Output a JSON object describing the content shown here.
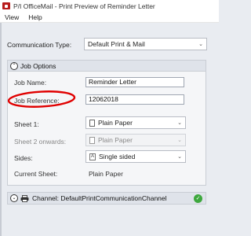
{
  "window": {
    "title": "P/I OfficeMail - Print Preview of Reminder Letter",
    "app_icon": "officemail-app-icon"
  },
  "menu": {
    "items": [
      {
        "label": "View"
      },
      {
        "label": "Help"
      }
    ]
  },
  "communication_type": {
    "label": "Communication Type:",
    "value": "Default Print & Mail"
  },
  "job_options": {
    "title": "Job Options",
    "expanded": true,
    "job_name": {
      "label": "Job Name:",
      "value": "Reminder Letter"
    },
    "job_reference": {
      "label": "Job Reference:",
      "value": "12062018"
    },
    "sheet1": {
      "label": "Sheet 1:",
      "value": "Plain Paper"
    },
    "sheet2": {
      "label": "Sheet 2 onwards:",
      "value": "Plain Paper"
    },
    "sides": {
      "label": "Sides:",
      "value": "Single sided"
    },
    "current_sheet": {
      "label": "Current Sheet:",
      "value": "Plain Paper"
    }
  },
  "channel": {
    "text": "Channel: DefaultPrintCommunicationChannel",
    "status": "ok",
    "status_color": "#3ea83e"
  },
  "annotation": {
    "color": "#e00000"
  }
}
